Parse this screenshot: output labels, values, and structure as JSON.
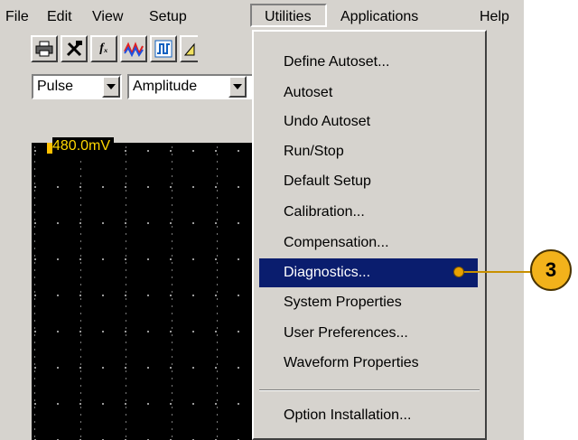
{
  "menubar": {
    "items": [
      "File",
      "Edit",
      "View",
      "Setup",
      "Utilities",
      "Applications",
      "Help"
    ]
  },
  "toolbar": {
    "icons": [
      "print-icon",
      "tools-icon",
      "math-function-icon",
      "waveform-icon",
      "measurement-icon",
      "cursor-icon"
    ],
    "math_label": "fₓ"
  },
  "filters": {
    "first_select": "Pulse",
    "second_select": "Amplitude"
  },
  "scope": {
    "scale_readout": "480.0mV"
  },
  "utilities_menu": {
    "items": [
      "Define Autoset...",
      "Autoset",
      "Undo Autoset",
      "Run/Stop",
      "Default Setup",
      "Calibration...",
      "Compensation...",
      "Diagnostics...",
      "System Properties",
      "User Preferences...",
      "Waveform Properties",
      "Option Installation..."
    ],
    "highlighted": "Diagnostics..."
  },
  "callout": {
    "number": "3"
  },
  "colors": {
    "highlight": "#0a1d6e",
    "callout": "#f2b21b",
    "readout": "#ffd700"
  }
}
